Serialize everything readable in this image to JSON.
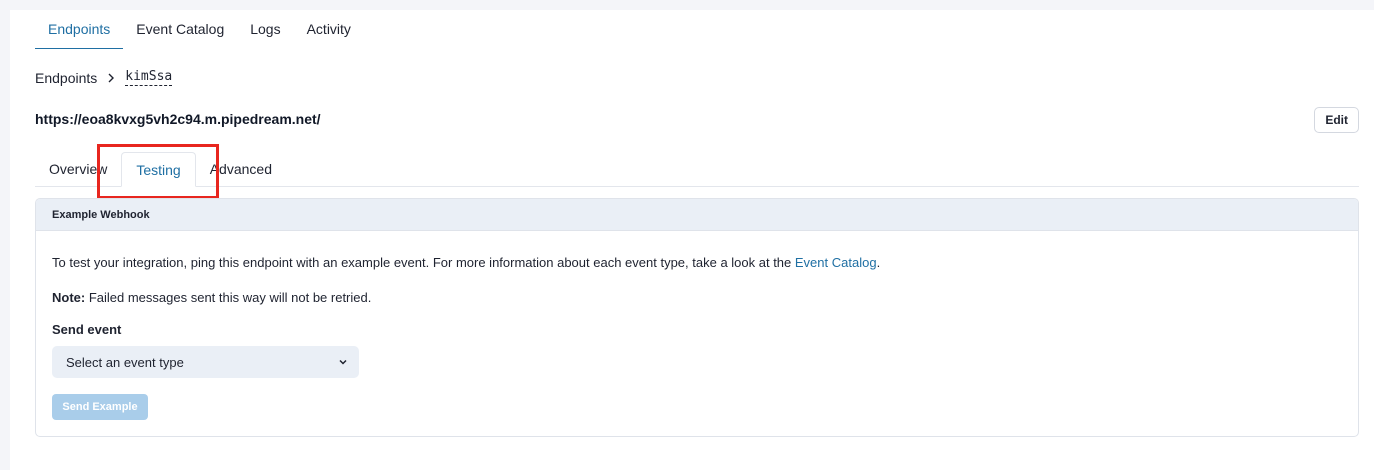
{
  "top_tabs": [
    {
      "label": "Endpoints"
    },
    {
      "label": "Event Catalog"
    },
    {
      "label": "Logs"
    },
    {
      "label": "Activity"
    }
  ],
  "breadcrumb": {
    "root": "Endpoints",
    "current": "kimSsa"
  },
  "endpoint": {
    "url": "https://eoa8kvxg5vh2c94.m.pipedream.net/",
    "edit_label": "Edit"
  },
  "sub_tabs": [
    {
      "label": "Overview"
    },
    {
      "label": "Testing"
    },
    {
      "label": "Advanced"
    }
  ],
  "card": {
    "title": "Example Webhook",
    "description_prefix": "To test your integration, ping this endpoint with an example event. For more information about each event type, take a look at the ",
    "description_link": "Event Catalog",
    "description_suffix": ".",
    "note_label": "Note:",
    "note_text": " Failed messages sent this way will not be retried.",
    "send_event_label": "Send event",
    "select_value": "Select an event type",
    "send_button_label": "Send Example"
  },
  "colors": {
    "accent": "#1f6fa3",
    "highlight": "#e8261f",
    "disabled_button": "#a9cdea"
  }
}
